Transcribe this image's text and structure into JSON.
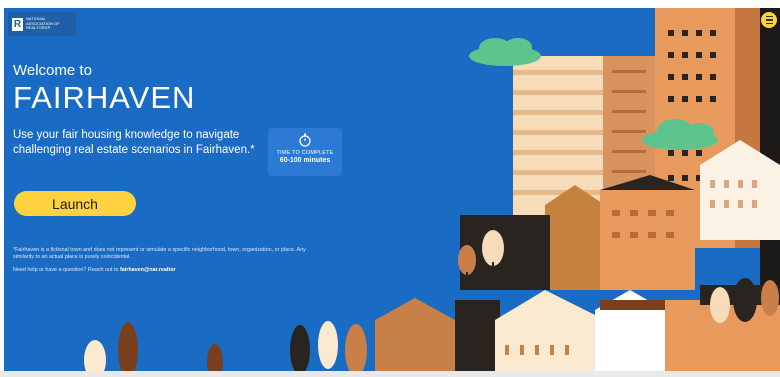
{
  "logo": {
    "mark": "R",
    "text": "NATIONAL ASSOCIATION OF REALTORS®"
  },
  "hero": {
    "welcome": "Welcome to",
    "title": "FAIRHAVEN",
    "description": "Use your fair housing knowledge to navigate challenging real estate scenarios in Fairhaven.*"
  },
  "time_card": {
    "icon": "stopwatch-icon",
    "label": "TIME TO COMPLETE",
    "value": "60-100 minutes"
  },
  "launch_label": "Launch",
  "disclaimer": "*Fairhaven is a fictional town and does not represent or simulate a specific neighborhood, town, organization, or place. Any similarity to an actual place is purely coincidental.",
  "help": {
    "text": "Need help or have a question? Reach out to ",
    "email": "fairhaven@nar.realtor"
  },
  "menu": {
    "icon": "hamburger-menu-icon"
  },
  "colors": {
    "background": "#1a6bc4",
    "accent": "#ffd23f",
    "building_tan": "#d9935f",
    "building_dark": "#2a2420",
    "cloud": "#5ec48e"
  }
}
